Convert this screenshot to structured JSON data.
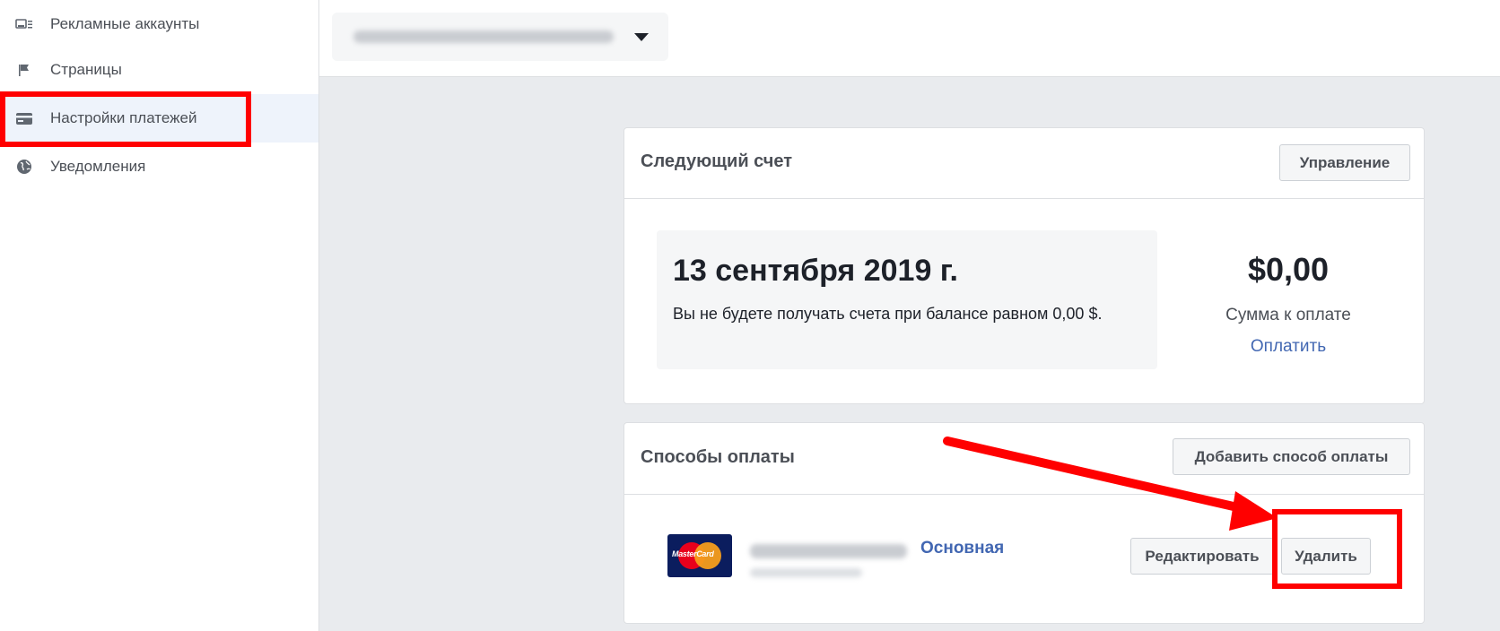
{
  "sidebar": {
    "items": [
      {
        "label": "Рекламные аккаунты",
        "icon": "ad-account-icon"
      },
      {
        "label": "Страницы",
        "icon": "flag-icon"
      },
      {
        "label": "Настройки платежей",
        "icon": "credit-card-icon",
        "active": true
      },
      {
        "label": "Уведомления",
        "icon": "globe-icon"
      }
    ]
  },
  "header": {
    "account_selector_icon": "chevron-down-icon"
  },
  "next_invoice": {
    "title": "Следующий счет",
    "manage_button": "Управление",
    "date": "13 сентября 2019 г.",
    "note": "Вы не будете получать счета при балансе равном 0,00 $.",
    "amount": "$0,00",
    "amount_label": "Сумма к оплате",
    "pay_link": "Оплатить"
  },
  "payment_methods": {
    "title": "Способы оплаты",
    "add_button": "Добавить способ оплаты",
    "methods": [
      {
        "card_brand": "MasterCard",
        "badge": "Основная",
        "edit_button": "Редактировать",
        "delete_button": "Удалить"
      }
    ]
  },
  "colors": {
    "accent_blue": "#4267b2",
    "highlight_red": "#ff0000",
    "active_bg": "#eef3fb",
    "page_bg": "#e9ebee"
  }
}
